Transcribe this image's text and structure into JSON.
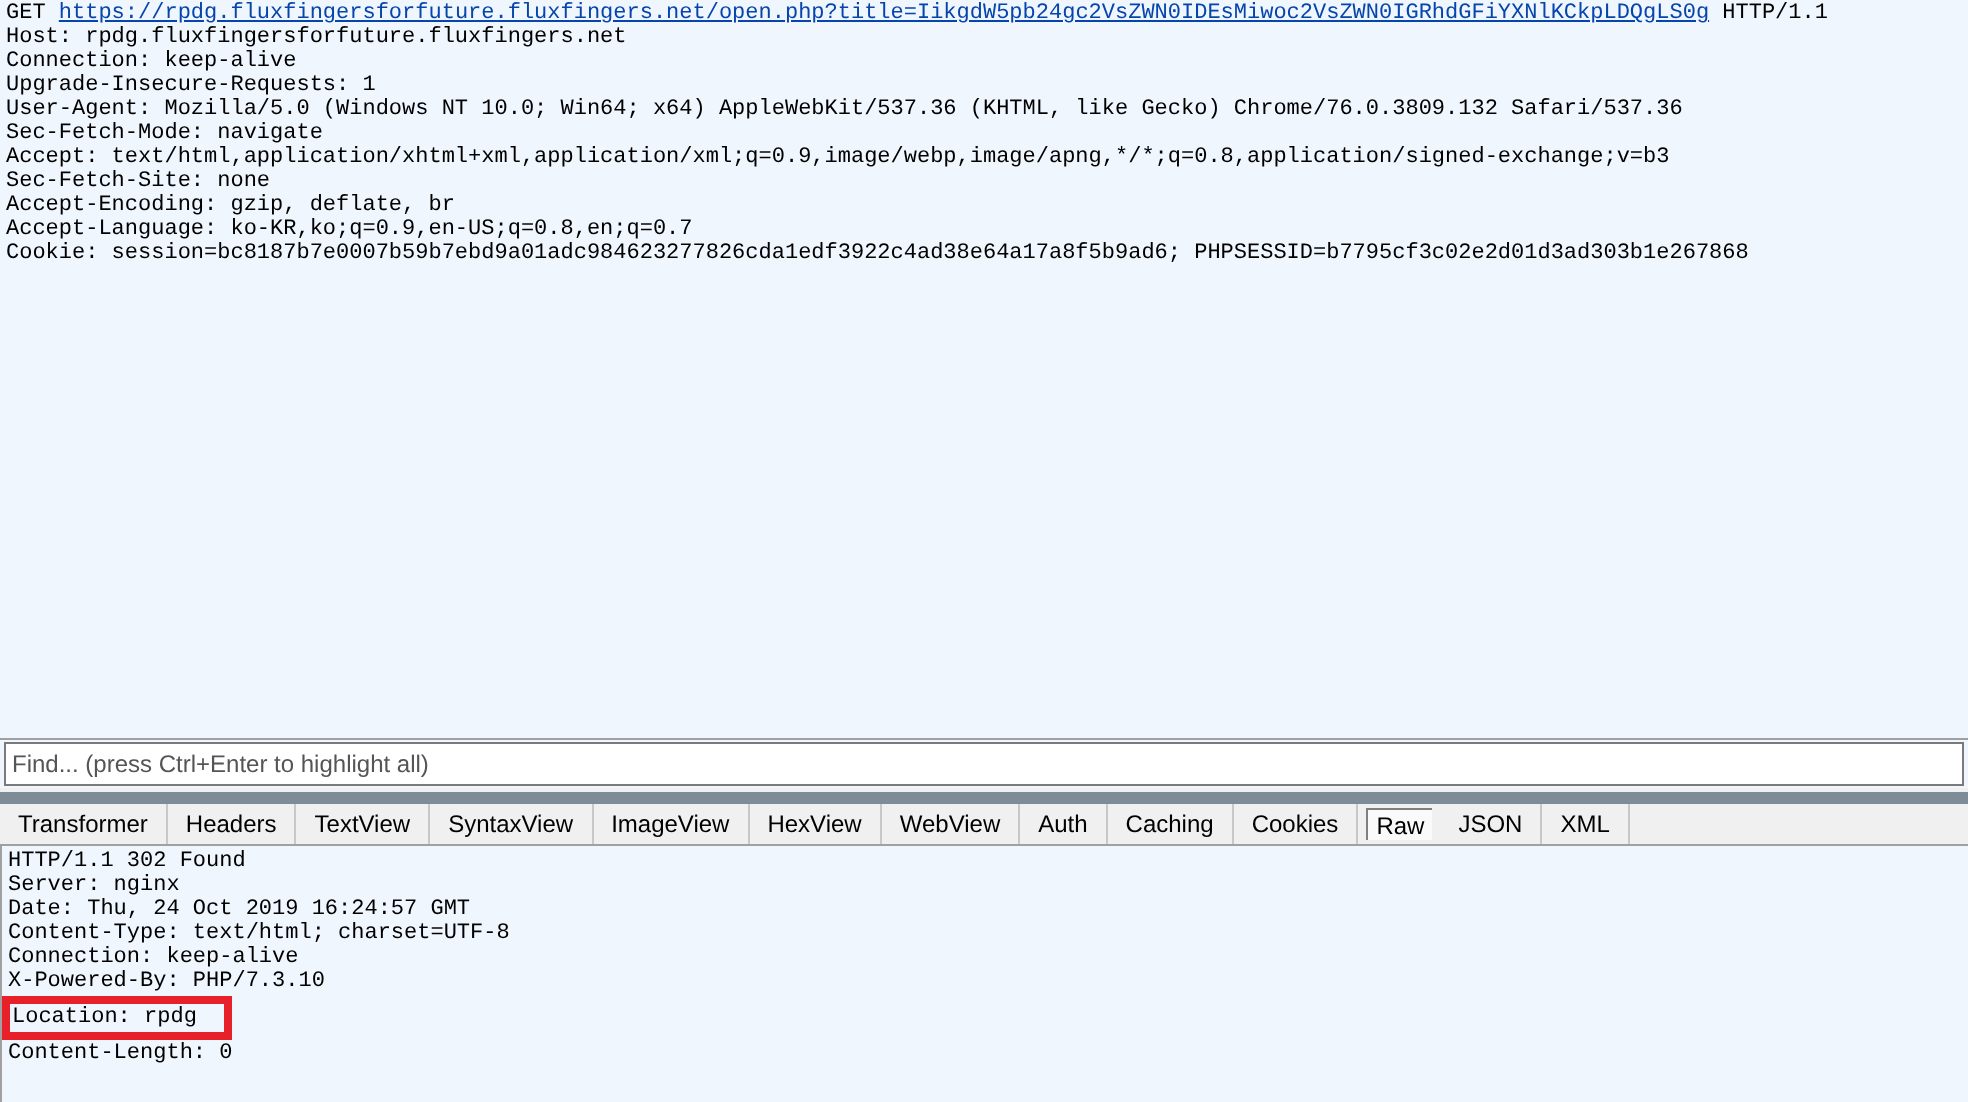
{
  "request": {
    "method": "GET",
    "url": "https://rpdg.fluxfingersforfuture.fluxfingers.net/open.php?title=IikgdW5pb24gc2VsZWN0IDEsMiwoc2VsZWN0IGRhdGFiYXNlKCkpLDQgLS0g",
    "version": "HTTP/1.1",
    "headers": [
      "Host: rpdg.fluxfingersforfuture.fluxfingers.net",
      "Connection: keep-alive",
      "Upgrade-Insecure-Requests: 1",
      "User-Agent: Mozilla/5.0 (Windows NT 10.0; Win64; x64) AppleWebKit/537.36 (KHTML, like Gecko) Chrome/76.0.3809.132 Safari/537.36",
      "Sec-Fetch-Mode: navigate",
      "Accept: text/html,application/xhtml+xml,application/xml;q=0.9,image/webp,image/apng,*/*;q=0.8,application/signed-exchange;v=b3",
      "Sec-Fetch-Site: none",
      "Accept-Encoding: gzip, deflate, br",
      "Accept-Language: ko-KR,ko;q=0.9,en-US;q=0.8,en;q=0.7",
      "Cookie: session=bc8187b7e0007b59b7ebd9a01adc984623277826cda1edf3922c4ad38e64a17a8f5b9ad6; PHPSESSID=b7795cf3c02e2d01d3ad303b1e267868"
    ]
  },
  "find": {
    "placeholder": "Find... (press Ctrl+Enter to highlight all)"
  },
  "tabs": [
    {
      "label": "Transformer",
      "selected": false
    },
    {
      "label": "Headers",
      "selected": false
    },
    {
      "label": "TextView",
      "selected": false
    },
    {
      "label": "SyntaxView",
      "selected": false
    },
    {
      "label": "ImageView",
      "selected": false
    },
    {
      "label": "HexView",
      "selected": false
    },
    {
      "label": "WebView",
      "selected": false
    },
    {
      "label": "Auth",
      "selected": false
    },
    {
      "label": "Caching",
      "selected": false
    },
    {
      "label": "Cookies",
      "selected": false
    },
    {
      "label": "Raw",
      "selected": true
    },
    {
      "label": "JSON",
      "selected": false
    },
    {
      "label": "XML",
      "selected": false
    }
  ],
  "response": {
    "lines": [
      {
        "text": "HTTP/1.1 302 Found",
        "highlighted": false
      },
      {
        "text": "Server: nginx",
        "highlighted": false
      },
      {
        "text": "Date: Thu, 24 Oct 2019 16:24:57 GMT",
        "highlighted": false
      },
      {
        "text": "Content-Type: text/html; charset=UTF-8",
        "highlighted": false
      },
      {
        "text": "Connection: keep-alive",
        "highlighted": false
      },
      {
        "text": "X-Powered-By: PHP/7.3.10",
        "highlighted": false
      },
      {
        "text": "Location: rpdg",
        "highlighted": true
      },
      {
        "text": "Content-Length: 0",
        "highlighted": false
      }
    ]
  }
}
